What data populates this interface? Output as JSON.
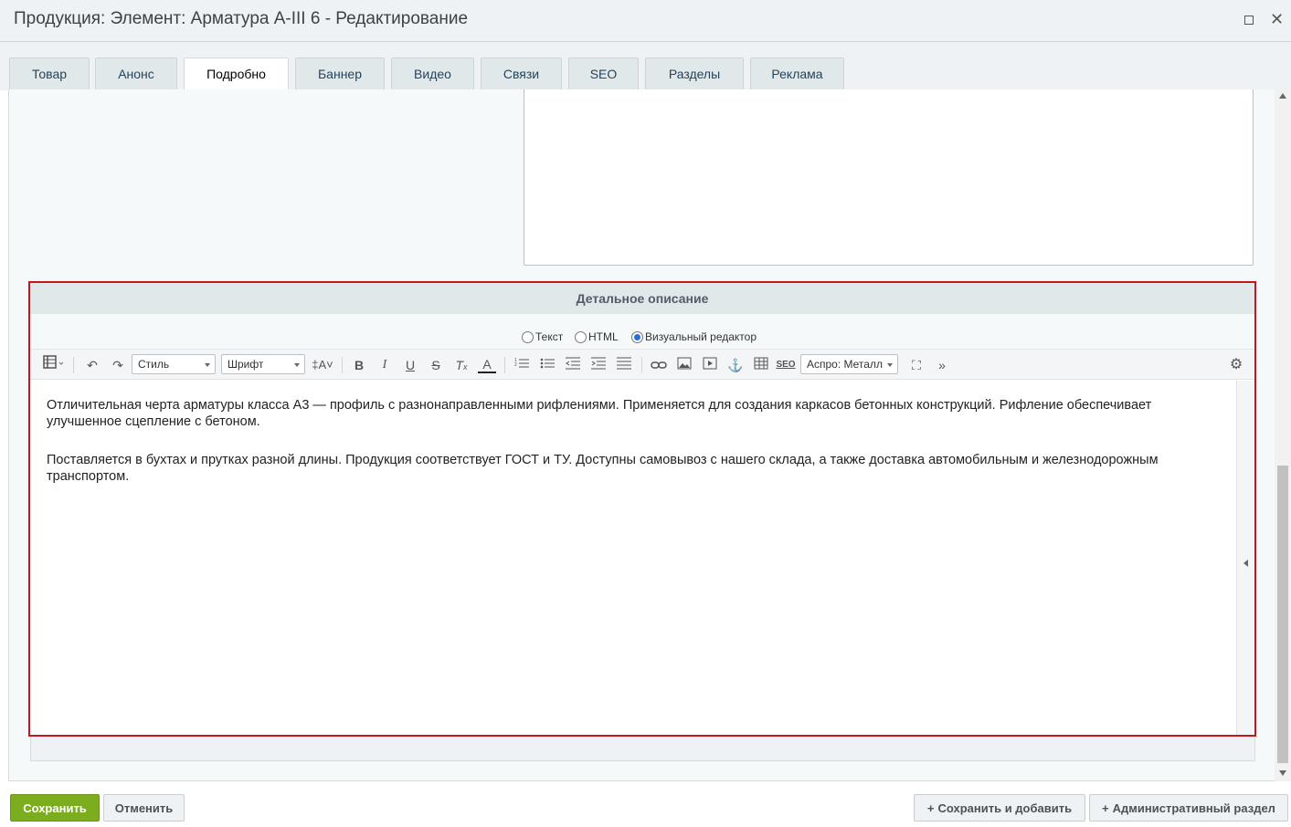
{
  "window": {
    "title": "Продукция: Элемент: Арматура А-III 6 - Редактирование",
    "maximize_icon": "maximize-icon",
    "close_icon": "close-icon"
  },
  "tabs": [
    {
      "label": "Товар",
      "active": false
    },
    {
      "label": "Анонс",
      "active": false
    },
    {
      "label": "Подробно",
      "active": true
    },
    {
      "label": "Баннер",
      "active": false
    },
    {
      "label": "Видео",
      "active": false
    },
    {
      "label": "Связи",
      "active": false
    },
    {
      "label": "SEO",
      "active": false
    },
    {
      "label": "Разделы",
      "active": false
    },
    {
      "label": "Реклама",
      "active": false
    }
  ],
  "detail": {
    "header": "Детальное описание",
    "modes": [
      {
        "label": "Текст",
        "selected": false
      },
      {
        "label": "HTML",
        "selected": false
      },
      {
        "label": "Визуальный редактор",
        "selected": true
      }
    ],
    "toolbar": {
      "style_select": "Стиль",
      "font_select": "Шрифт",
      "template_select": "Аспро: Металл",
      "seo_label": "SEO"
    },
    "content": {
      "paragraph_1": "Отличительная черта арматуры класса А3 — профиль с разнонаправленными рифлениями. Применяется для создания каркасов бетонных конструкций. Рифление обеспечивает улучшенное сцепление с бетоном.",
      "paragraph_2": "Поставляется в бухтах и прутках разной длины. Продукция соответствует ГОСТ и ТУ. Доступны самовывоз с нашего склада, а также доставка автомобильным и железнодорожным транспортом."
    }
  },
  "footer": {
    "save": "Сохранить",
    "cancel": "Отменить",
    "save_and_add": "Сохранить и добавить",
    "admin_section": "Административный раздел"
  },
  "colors": {
    "highlight_border": "#c4161c",
    "save_button": "#7cad1e",
    "tab_bar": "#eef2f4"
  }
}
